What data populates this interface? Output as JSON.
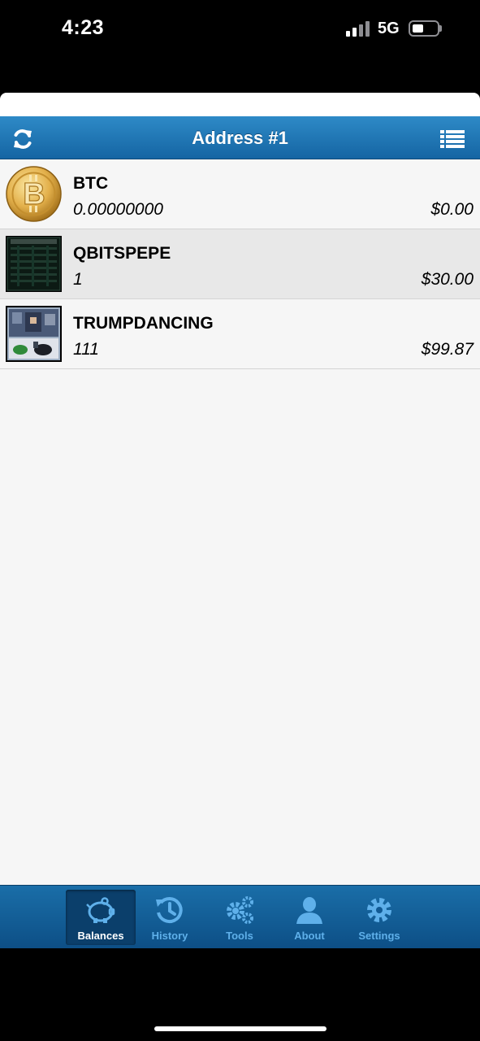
{
  "status_bar": {
    "time": "4:23",
    "network": "5G"
  },
  "header": {
    "title": "Address #1"
  },
  "assets": [
    {
      "name": "BTC",
      "quantity": "0.00000000",
      "value": "$0.00",
      "icon": "bitcoin-coin-icon"
    },
    {
      "name": "QBITSPEPE",
      "quantity": "1",
      "value": "$30.00",
      "icon": "qbitspepe-card-image"
    },
    {
      "name": "TRUMPDANCING",
      "quantity": "111",
      "value": "$99.87",
      "icon": "trumpdancing-card-image"
    }
  ],
  "tabbar": {
    "items": [
      {
        "label": "Balances",
        "icon": "piggy-bank-icon",
        "active": true
      },
      {
        "label": "History",
        "icon": "history-clock-icon",
        "active": false
      },
      {
        "label": "Tools",
        "icon": "gears-icon",
        "active": false
      },
      {
        "label": "About",
        "icon": "person-icon",
        "active": false
      },
      {
        "label": "Settings",
        "icon": "gear-icon",
        "active": false
      }
    ]
  },
  "colors": {
    "header": "#1f7bbd",
    "tabbar": "#0d4f86",
    "tab_label": "#5fb0ea",
    "content_bg": "#f6f6f6"
  }
}
